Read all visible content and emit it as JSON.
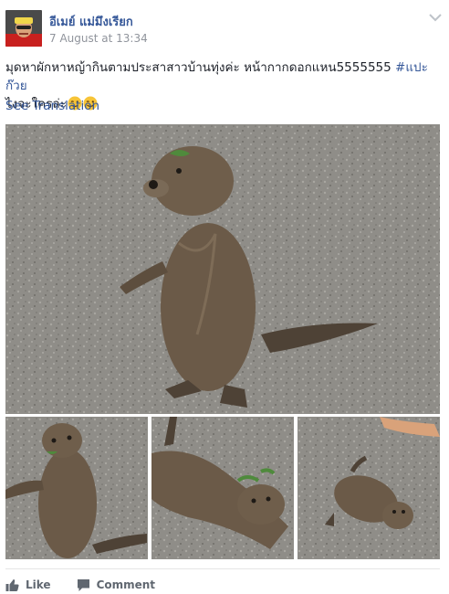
{
  "post": {
    "author_name": "อีเมย์ แม่มึงเรียก",
    "timestamp": "7 August at 13:34",
    "text_main": "มุดหาผักหาหญ้ากินตามประสาสาวบ้านทุ่งค่ะ หน้ากากดอกแหน5555555 ",
    "hashtag": "#แปะก๊วย",
    "text_second": "ไงจะใครล่ะ",
    "see_translation": "See Translation"
  },
  "photos": [
    {
      "subject": "otter standing on gravel"
    },
    {
      "subject": "otter standing, close"
    },
    {
      "subject": "otter walking with plants"
    },
    {
      "subject": "otter on gravel near hand"
    }
  ],
  "actions": {
    "like_label": "Like",
    "comment_label": "Comment"
  },
  "icons": {
    "options": "chevron-down-icon",
    "like": "thumbs-up-icon",
    "comment": "comment-bubble-icon",
    "emoji": "wink-emoji-icon"
  },
  "colors": {
    "link": "#365899",
    "meta": "#90949c",
    "action": "#606770",
    "gravel": "#8f8d88",
    "otter": "#6b5a48"
  }
}
